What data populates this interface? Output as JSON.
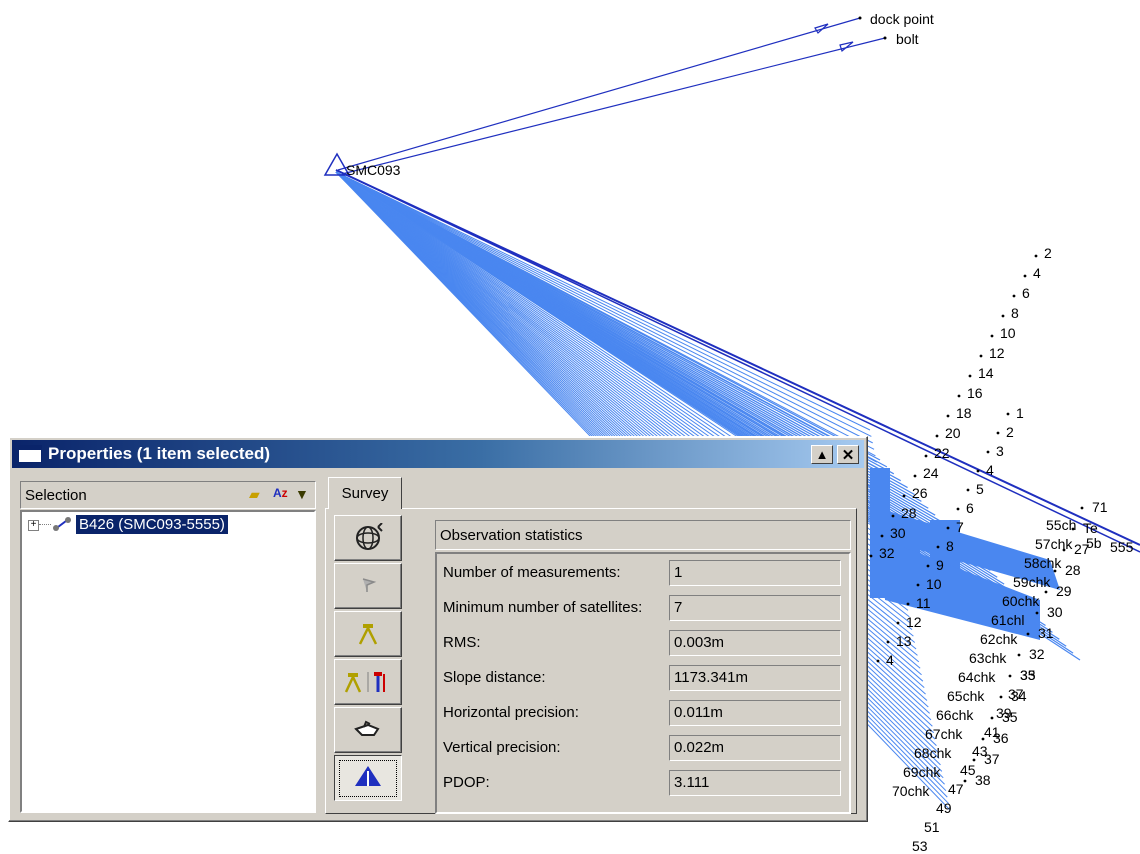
{
  "canvas": {
    "labels": {
      "dock_point": "dock point",
      "bolt": "bolt",
      "station": "SMC093",
      "chk": [
        "55ch",
        "57chk",
        "58chk",
        "59chk",
        "60chk",
        "61chl",
        "62chk",
        "63chk",
        "64chk",
        "65chk",
        "66chk",
        "67chk",
        "68chk",
        "69chk",
        "70chk"
      ],
      "cut": [
        "5b",
        "555"
      ],
      "n_upper": [
        "2",
        "4",
        "6",
        "8",
        "10",
        "12",
        "14",
        "16",
        "18",
        "20",
        "22",
        "24",
        "26",
        "28",
        "30",
        "32"
      ],
      "n_mid": [
        "1",
        "2",
        "3",
        "4",
        "5",
        "6",
        "7",
        "8",
        "9",
        "10",
        "11",
        "12",
        "13",
        "4"
      ],
      "n_low": [
        "35",
        "37",
        "39",
        "41",
        "43",
        "45",
        "47",
        "49",
        "51",
        "53"
      ],
      "n_right": [
        "71",
        "Te",
        "27",
        "28",
        "29",
        "30",
        "31",
        "32",
        "33",
        "34",
        "35",
        "36",
        "37",
        "38"
      ]
    },
    "colors": {
      "rays": "#4a87f0",
      "lines": "#1f2fbf",
      "station": "#1f2fbf"
    }
  },
  "window": {
    "title": "Properties (1 item selected)",
    "minimize_glyph": "▲",
    "close_glyph": "✕"
  },
  "selection": {
    "header": "Selection",
    "tree_item": "B426 (SMC093-5555)",
    "expander": "+"
  },
  "tabs": [
    {
      "label": "Survey"
    }
  ],
  "buttons": [
    {
      "icon": "satellite-globe-icon"
    },
    {
      "icon": "flag-icon"
    },
    {
      "icon": "tripod-icon"
    },
    {
      "icon": "tripod-rover-icon"
    },
    {
      "icon": "hand-point-icon"
    },
    {
      "icon": "triangle-stats-icon"
    }
  ],
  "stats": {
    "header": "Observation statistics",
    "rows": [
      {
        "label": "Number of measurements:",
        "value": "1"
      },
      {
        "label": "Minimum number of satellites:",
        "value": "7"
      },
      {
        "label": "RMS:",
        "value": "0.003m"
      },
      {
        "label": "Slope distance:",
        "value": "1173.341m"
      },
      {
        "label": "Horizontal precision:",
        "value": "0.011m"
      },
      {
        "label": "Vertical precision:",
        "value": "0.022m"
      },
      {
        "label": "PDOP:",
        "value": "3.111"
      }
    ]
  }
}
